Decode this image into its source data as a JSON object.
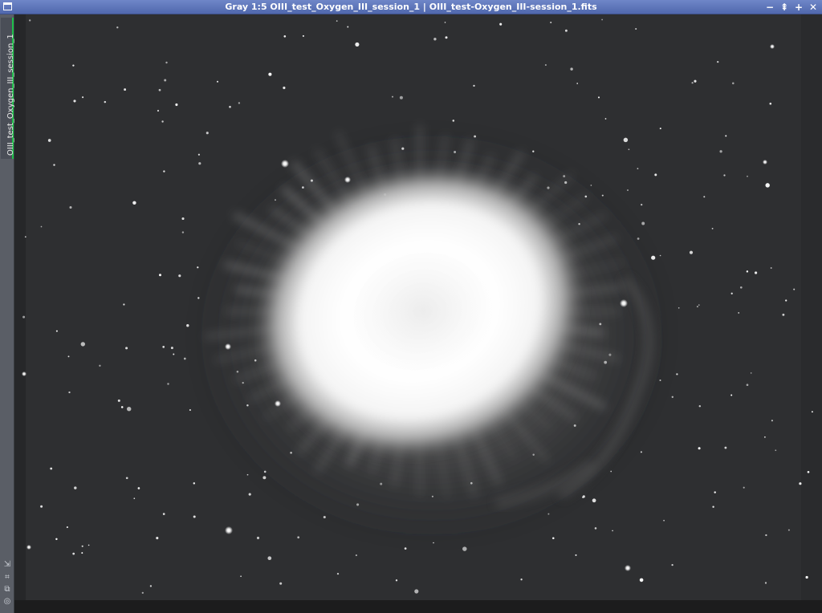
{
  "window": {
    "title": "Gray 1:5 OIII_test_Oxygen_III_session_1 | OIII_test-Oxygen_III-session_1.fits",
    "controls": {
      "minimize": "−",
      "shade": "⇞",
      "maximize": "+",
      "close": "✕"
    }
  },
  "sidebar": {
    "tab_label": "OIII_test_Oxygen_III_session_1",
    "icons": [
      "corner-arrow-icon",
      "fit-icon",
      "clone-icon",
      "settings-icon"
    ]
  },
  "image": {
    "subject": "planetary-nebula",
    "colors": {
      "background": "#2e2f31",
      "nebula": "#ffffff",
      "stars": "#ffffff"
    }
  }
}
